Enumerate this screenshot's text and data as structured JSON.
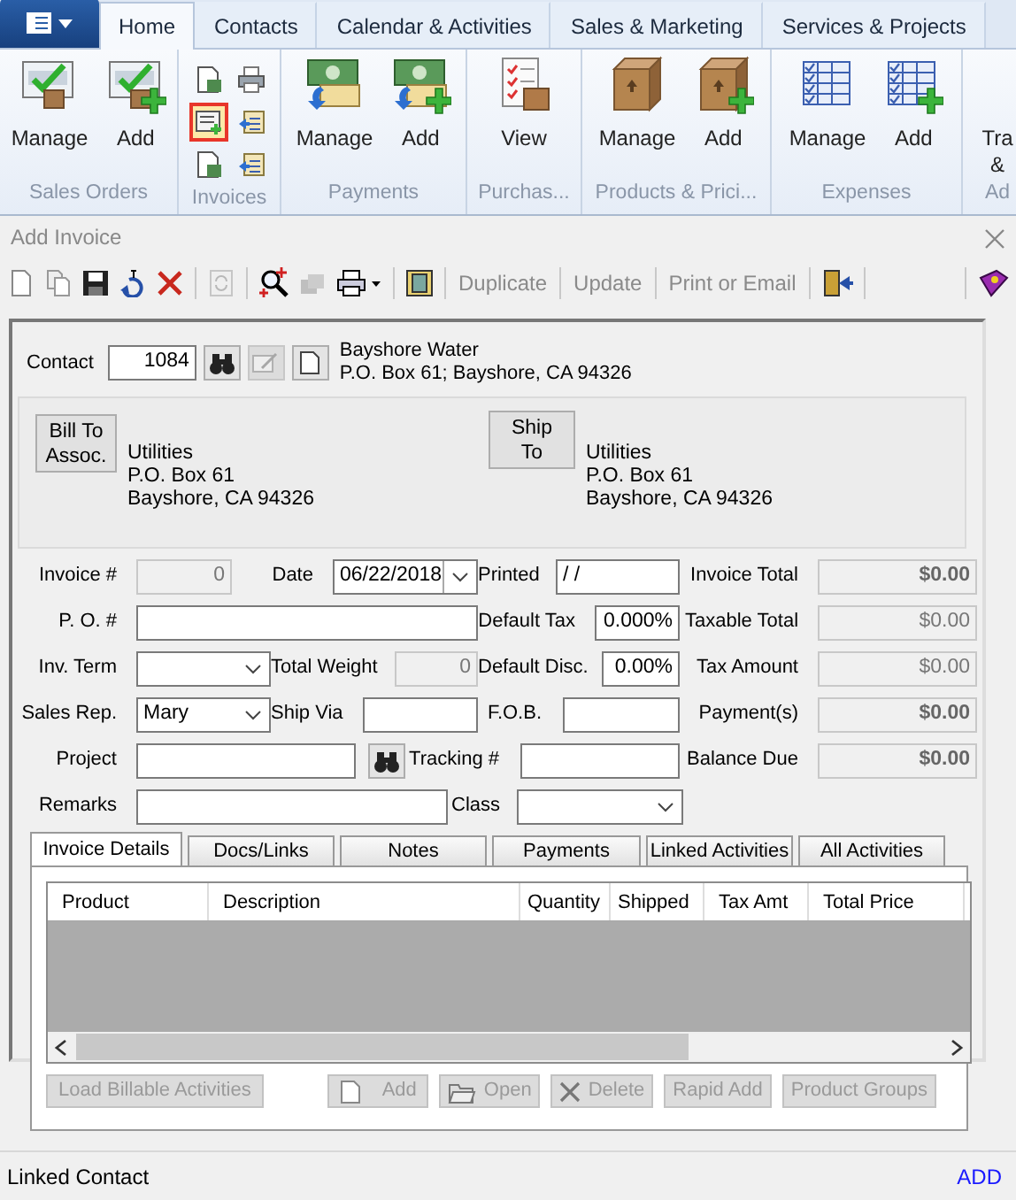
{
  "ribbon": {
    "tabs": [
      {
        "label": "Home",
        "selected": true
      },
      {
        "label": "Contacts",
        "selected": false
      },
      {
        "label": "Calendar & Activities",
        "selected": false
      },
      {
        "label": "Sales & Marketing",
        "selected": false
      },
      {
        "label": "Services & Projects",
        "selected": false
      }
    ],
    "groups": [
      {
        "label": "Sales Orders",
        "kind": "large",
        "buttons": [
          {
            "lines": [
              "Manage"
            ]
          },
          {
            "lines": [
              "Add"
            ]
          }
        ]
      },
      {
        "label": "Invoices",
        "kind": "small",
        "buttons": [
          {
            "selected": false
          },
          {
            "selected": false
          },
          {
            "selected": true
          },
          {
            "selected": false
          },
          {
            "selected": false
          },
          {
            "selected": false
          }
        ]
      },
      {
        "label": "Payments",
        "kind": "large",
        "buttons": [
          {
            "lines": [
              "Manage"
            ]
          },
          {
            "lines": [
              "Add"
            ]
          }
        ]
      },
      {
        "label": "Purchas...",
        "kind": "large",
        "buttons": [
          {
            "lines": [
              "View"
            ]
          }
        ]
      },
      {
        "label": "Products & Prici...",
        "kind": "large",
        "buttons": [
          {
            "lines": [
              "Manage"
            ]
          },
          {
            "lines": [
              "Add"
            ]
          }
        ]
      },
      {
        "label": "Expenses",
        "kind": "large",
        "buttons": [
          {
            "lines": [
              "Manage"
            ]
          },
          {
            "lines": [
              "Add"
            ]
          }
        ]
      },
      {
        "label": "Ad",
        "kind": "large",
        "buttons": [
          {
            "lines": [
              "Tra",
              "&"
            ]
          }
        ]
      }
    ]
  },
  "dialog": {
    "title": "Add Invoice"
  },
  "toolbar": [
    {
      "kind": "icon",
      "disabled": false
    },
    {
      "kind": "icon",
      "disabled": false
    },
    {
      "kind": "icon",
      "disabled": false
    },
    {
      "kind": "icon",
      "disabled": false
    },
    {
      "kind": "icon",
      "disabled": false
    },
    {
      "kind": "separator"
    },
    {
      "kind": "icon",
      "disabled": true
    },
    {
      "kind": "separator"
    },
    {
      "kind": "icon",
      "disabled": false
    },
    {
      "kind": "icon",
      "disabled": true
    },
    {
      "kind": "icon",
      "disabled": false
    },
    {
      "kind": "separator"
    },
    {
      "kind": "icon",
      "disabled": false
    },
    {
      "kind": "separator"
    },
    {
      "kind": "text",
      "label": "Duplicate",
      "disabled": true
    },
    {
      "kind": "separator"
    },
    {
      "kind": "text",
      "label": "Update",
      "disabled": true
    },
    {
      "kind": "separator"
    },
    {
      "kind": "text",
      "label": "Print or Email",
      "disabled": true
    },
    {
      "kind": "separator"
    },
    {
      "kind": "icon",
      "disabled": false
    },
    {
      "kind": "separator"
    },
    {
      "kind": "gap"
    },
    {
      "kind": "separator"
    },
    {
      "kind": "icon",
      "disabled": false
    }
  ],
  "contact": {
    "label": "Contact",
    "value": "1084",
    "edit_disabled": true,
    "name_lines": [
      "Bayshore Water",
      "P.O. Box 61; Bayshore, CA 94326"
    ]
  },
  "addresses": [
    {
      "button": [
        "Bill To",
        "Assoc."
      ],
      "lines": [
        "Utilities",
        "P.O. Box 61",
        "Bayshore, CA 94326"
      ]
    },
    {
      "button": [
        "Ship",
        "To"
      ],
      "lines": [
        "Utilities",
        "P.O. Box 61",
        "Bayshore, CA 94326"
      ]
    }
  ],
  "form_rows": [
    [
      {
        "kind": "label",
        "text": "Invoice #"
      },
      {
        "kind": "readonly",
        "value": "0",
        "bold": false
      },
      {
        "kind": "label",
        "text": "Date"
      },
      {
        "kind": "date",
        "value": "06/22/2018"
      },
      {
        "kind": "label",
        "text": "Printed"
      },
      {
        "kind": "input",
        "value": " / /"
      },
      {
        "kind": "label",
        "text": "Invoice Total"
      },
      {
        "kind": "readonly",
        "value": "$0.00",
        "bold": true
      }
    ],
    [
      {
        "kind": "label",
        "text": "P. O. #"
      },
      {
        "kind": "input"
      },
      {
        "kind": "label",
        "text": "Default Tax"
      },
      {
        "kind": "number",
        "value": "0.000%"
      },
      {
        "kind": "label",
        "text": "Taxable Total"
      },
      {
        "kind": "readonly",
        "value": "$0.00",
        "bold": false
      }
    ],
    [
      {
        "kind": "label",
        "text": "Inv. Term"
      },
      {
        "kind": "select"
      },
      {
        "kind": "label",
        "text": "Total Weight"
      },
      {
        "kind": "readonly",
        "value": "0",
        "bold": false
      },
      {
        "kind": "label",
        "text": "Default Disc."
      },
      {
        "kind": "number",
        "value": "0.00%"
      },
      {
        "kind": "label",
        "text": "Tax Amount"
      },
      {
        "kind": "readonly",
        "value": "$0.00",
        "bold": false
      }
    ],
    [
      {
        "kind": "label",
        "text": "Sales Rep."
      },
      {
        "kind": "select",
        "value": "Mary"
      },
      {
        "kind": "label",
        "text": "Ship Via"
      },
      {
        "kind": "input"
      },
      {
        "kind": "label",
        "text": "F.O.B."
      },
      {
        "kind": "input"
      },
      {
        "kind": "label",
        "text": "Payment(s)"
      },
      {
        "kind": "readonly",
        "value": "$0.00",
        "bold": true
      }
    ],
    [
      {
        "kind": "label",
        "text": "Project"
      },
      {
        "kind": "input"
      },
      {
        "kind": "search"
      },
      {
        "kind": "label",
        "text": "Tracking #"
      },
      {
        "kind": "input"
      },
      {
        "kind": "label",
        "text": "Balance Due"
      },
      {
        "kind": "readonly",
        "value": "$0.00",
        "bold": true
      }
    ],
    [
      {
        "kind": "label",
        "text": "Remarks"
      },
      {
        "kind": "input"
      },
      {
        "kind": "label",
        "text": "Class"
      },
      {
        "kind": "select"
      }
    ]
  ],
  "detail_tabs": [
    {
      "label": "Invoice Details",
      "selected": true
    },
    {
      "label": "Docs/Links",
      "selected": false
    },
    {
      "label": "Notes",
      "selected": false
    },
    {
      "label": "Payments",
      "selected": false
    },
    {
      "label": "Linked Activities",
      "selected": false
    },
    {
      "label": "All Activities",
      "selected": false
    }
  ],
  "table": {
    "columns": [
      "Product",
      "Description",
      "Quantity",
      "Shipped",
      "Tax Amt",
      "Total Price"
    ]
  },
  "actions": [
    {
      "label": "Load Billable Activities",
      "disabled": true
    },
    {
      "label": "Add",
      "disabled": true
    },
    {
      "label": "Open",
      "disabled": true
    },
    {
      "label": "Delete",
      "disabled": true
    },
    {
      "label": "Rapid Add",
      "disabled": true
    },
    {
      "label": "Product Groups",
      "disabled": true
    }
  ],
  "status_bar": {
    "left": "Linked Contact",
    "right": "ADD"
  }
}
